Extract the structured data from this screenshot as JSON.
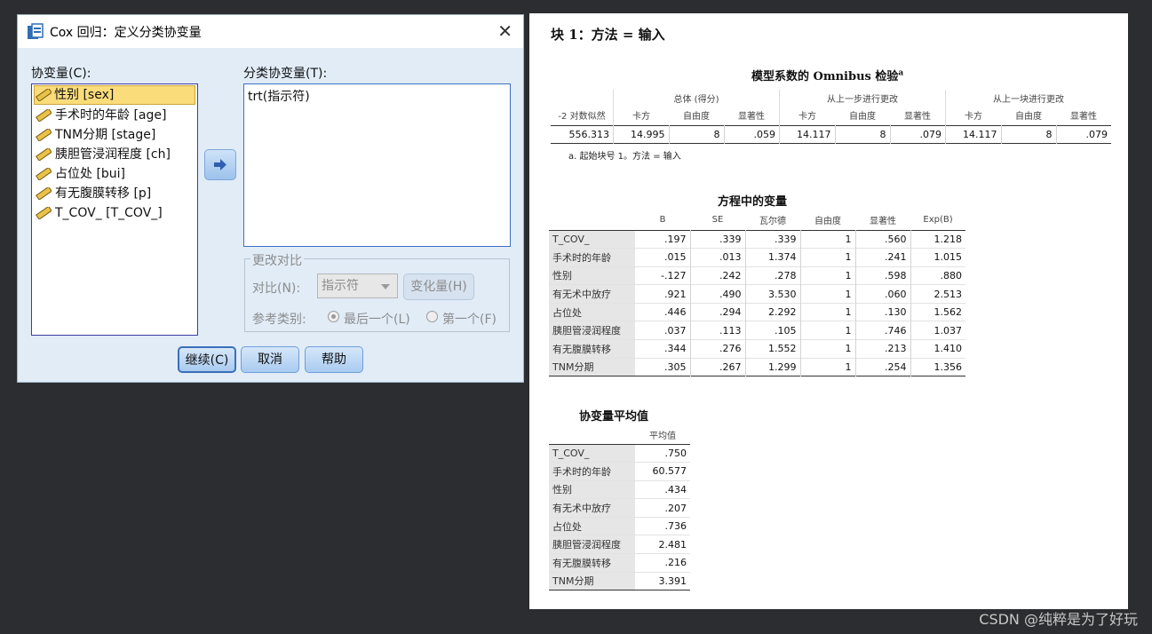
{
  "dialog": {
    "title": "Cox 回归：定义分类协变量",
    "covariates_label": "协变量(C):",
    "covariates": [
      "性别 [sex]",
      "手术时的年龄 [age]",
      "TNM分期 [stage]",
      "胰胆管浸润程度 [ch]",
      "占位处 [bui]",
      "有无腹膜转移 [p]",
      "T_COV_ [T_COV_]"
    ],
    "categorical_label": "分类协变量(T):",
    "categorical_items": [
      "trt(指示符)"
    ],
    "change_contrast": {
      "title": "更改对比",
      "contrast_label": "对比(N):",
      "contrast_value": "指示符",
      "change_button": "变化量(H)",
      "reference_label": "参考类别:",
      "last_option": "最后一个(L)",
      "first_option": "第一个(F)"
    },
    "buttons": {
      "continue": "继续(C)",
      "cancel": "取消",
      "help": "帮助"
    }
  },
  "output": {
    "block_heading": "块 1：方法 = 输入",
    "omnibus": {
      "title": "模型系数的 Omnibus 检验",
      "title_sup": "a",
      "group_headers": [
        "总体 (得分)",
        "从上一步进行更改",
        "从上一块进行更改"
      ],
      "col_headers": [
        "-2 对数似然",
        "卡方",
        "自由度",
        "显著性",
        "卡方",
        "自由度",
        "显著性",
        "卡方",
        "自由度",
        "显著性"
      ],
      "row": [
        "556.313",
        "14.995",
        "8",
        ".059",
        "14.117",
        "8",
        ".079",
        "14.117",
        "8",
        ".079"
      ],
      "footnote": "a. 起始块号 1。方法 = 输入"
    },
    "variables": {
      "title": "方程中的变量",
      "headers": [
        "B",
        "SE",
        "瓦尔德",
        "自由度",
        "显著性",
        "Exp(B)"
      ],
      "rows": [
        {
          "label": "T_COV_",
          "values": [
            ".197",
            ".339",
            ".339",
            "1",
            ".560",
            "1.218"
          ]
        },
        {
          "label": "手术时的年龄",
          "values": [
            ".015",
            ".013",
            "1.374",
            "1",
            ".241",
            "1.015"
          ]
        },
        {
          "label": "性别",
          "values": [
            "-.127",
            ".242",
            ".278",
            "1",
            ".598",
            ".880"
          ]
        },
        {
          "label": "有无术中放疗",
          "values": [
            ".921",
            ".490",
            "3.530",
            "1",
            ".060",
            "2.513"
          ]
        },
        {
          "label": "占位处",
          "values": [
            ".446",
            ".294",
            "2.292",
            "1",
            ".130",
            "1.562"
          ]
        },
        {
          "label": "胰胆管浸润程度",
          "values": [
            ".037",
            ".113",
            ".105",
            "1",
            ".746",
            "1.037"
          ]
        },
        {
          "label": "有无腹膜转移",
          "values": [
            ".344",
            ".276",
            "1.552",
            "1",
            ".213",
            "1.410"
          ]
        },
        {
          "label": "TNM分期",
          "values": [
            ".305",
            ".267",
            "1.299",
            "1",
            ".254",
            "1.356"
          ]
        }
      ]
    },
    "means": {
      "title": "协变量平均值",
      "header": "平均值",
      "rows": [
        {
          "label": "T_COV_",
          "value": ".750"
        },
        {
          "label": "手术时的年龄",
          "value": "60.577"
        },
        {
          "label": "性别",
          "value": ".434"
        },
        {
          "label": "有无术中放疗",
          "value": ".207"
        },
        {
          "label": "占位处",
          "value": ".736"
        },
        {
          "label": "胰胆管浸润程度",
          "value": "2.481"
        },
        {
          "label": "有无腹膜转移",
          "value": ".216"
        },
        {
          "label": "TNM分期",
          "value": "3.391"
        }
      ]
    }
  },
  "watermark": "CSDN @纯粹是为了好玩"
}
